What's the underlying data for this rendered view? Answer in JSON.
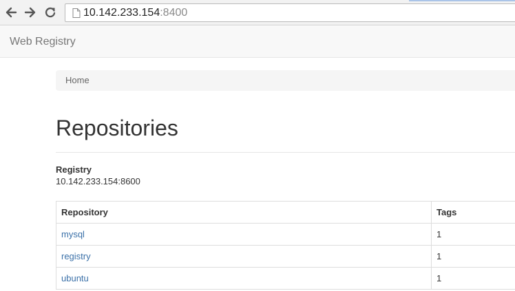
{
  "browser": {
    "url_host": "10.142.233.154",
    "url_port": ":8400",
    "icons": [
      "back-arrow-icon",
      "forward-arrow-icon",
      "reload-icon",
      "page-icon"
    ]
  },
  "navbar": {
    "brand": "Web Registry"
  },
  "breadcrumb": {
    "items": [
      {
        "label": "Home"
      }
    ]
  },
  "main": {
    "title": "Repositories",
    "registry_label": "Registry",
    "registry_value": "10.142.233.154:8600",
    "table": {
      "headers": [
        "Repository",
        "Tags"
      ],
      "rows": [
        {
          "repository": "mysql",
          "tags": "1"
        },
        {
          "repository": "registry",
          "tags": "1"
        },
        {
          "repository": "ubuntu",
          "tags": "1"
        }
      ]
    }
  },
  "colors": {
    "link": "#3a70a8",
    "navbar_bg": "#f8f8f8",
    "breadcrumb_bg": "#f5f5f5"
  }
}
